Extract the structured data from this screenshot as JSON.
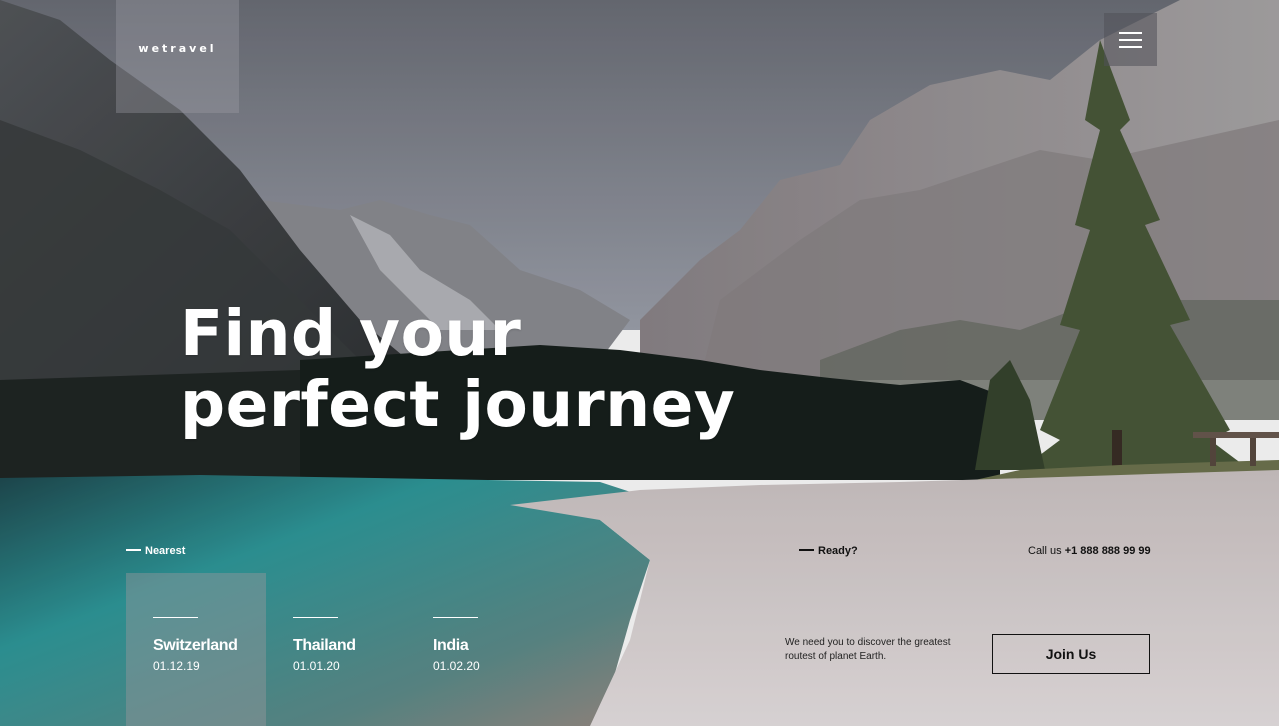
{
  "brand": {
    "name": "wetravel"
  },
  "hero": {
    "line1": "Find your",
    "line2": "perfect journey"
  },
  "nearest": {
    "label": "Nearest",
    "destinations": [
      {
        "name": "Switzerland",
        "date": "01.12.19",
        "active": true
      },
      {
        "name": "Thailand",
        "date": "01.01.20",
        "active": false
      },
      {
        "name": "India",
        "date": "01.02.20",
        "active": false
      }
    ]
  },
  "cta": {
    "label": "Ready?",
    "call_prefix": "Call us",
    "phone": "+1 888 888 99 99",
    "tagline": "We need you to discover the greatest routest of planet Earth.",
    "join_label": "Join Us"
  },
  "icons": {
    "menu": "hamburger-icon"
  }
}
